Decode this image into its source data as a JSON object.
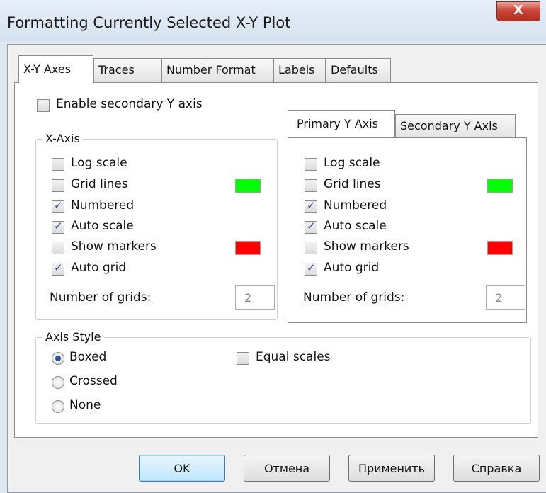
{
  "window": {
    "title": "Formatting Currently Selected X-Y Plot",
    "close_label": "X"
  },
  "tabs": [
    "X-Y Axes",
    "Traces",
    "Number Format",
    "Labels",
    "Defaults"
  ],
  "enable_secondary": {
    "label": "Enable secondary Y axis",
    "checked": false
  },
  "x_axis": {
    "legend": "X-Axis",
    "log_scale": "Log scale",
    "grid_lines": "Grid lines",
    "numbered": "Numbered",
    "auto_scale": "Auto scale",
    "show_markers": "Show markers",
    "auto_grid": "Auto grid",
    "number_of_grids_label": "Number of grids:",
    "number_of_grids": "2",
    "grid_color": "#00ff00",
    "marker_color": "#ff0000"
  },
  "y_tabs": [
    "Primary Y Axis",
    "Secondary Y Axis"
  ],
  "y_axis": {
    "log_scale": "Log scale",
    "grid_lines": "Grid lines",
    "numbered": "Numbered",
    "auto_scale": "Auto scale",
    "show_markers": "Show markers",
    "auto_grid": "Auto grid",
    "number_of_grids_label": "Number of grids:",
    "number_of_grids": "2",
    "grid_color": "#00ff00",
    "marker_color": "#ff0000"
  },
  "axis_style": {
    "legend": "Axis Style",
    "boxed": "Boxed",
    "crossed": "Crossed",
    "none": "None",
    "selected": "Boxed",
    "equal_scales": "Equal scales"
  },
  "buttons": {
    "ok": "OK",
    "cancel": "Отмена",
    "apply": "Применить",
    "help": "Справка"
  }
}
